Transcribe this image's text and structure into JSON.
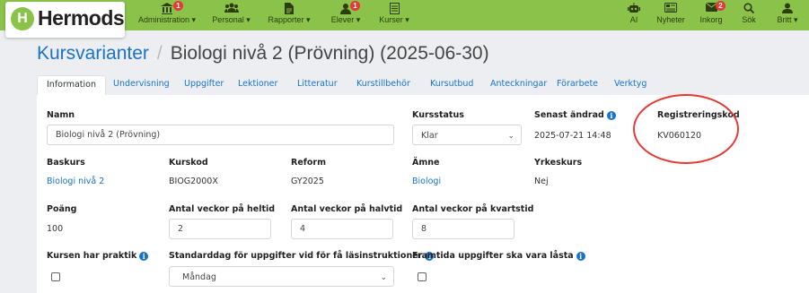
{
  "brand": {
    "logo_letter": "H",
    "name": "Hermods"
  },
  "nav_left": [
    {
      "label": "Administration ▾",
      "badge": "1"
    },
    {
      "label": "Personal ▾",
      "badge": ""
    },
    {
      "label": "Rapporter ▾",
      "badge": ""
    },
    {
      "label": "Elever ▾",
      "badge": "1"
    },
    {
      "label": "Kurser ▾",
      "badge": ""
    }
  ],
  "nav_right": [
    {
      "label": "AI",
      "badge": ""
    },
    {
      "label": "Nyheter",
      "badge": ""
    },
    {
      "label": "Inkorg",
      "badge": "2"
    },
    {
      "label": "Sök",
      "badge": ""
    },
    {
      "label": "Britt ▾",
      "badge": ""
    }
  ],
  "breadcrumb": {
    "parent": "Kursvarianter",
    "separator": "/",
    "current": "Biologi nivå 2 (Prövning) (2025-06-30)"
  },
  "tabs": [
    "Information",
    "Undervisning",
    "Uppgifter",
    "Lektioner",
    "Litteratur",
    "Kurstillbehör",
    "Kursutbud",
    "Anteckningar",
    "Förarbete",
    "Verktyg"
  ],
  "active_tab": "Information",
  "form": {
    "namn": {
      "label": "Namn",
      "value": "Biologi nivå 2 (Prövning)"
    },
    "kursstatus": {
      "label": "Kursstatus",
      "value": "Klar"
    },
    "senast_andrad": {
      "label": "Senast ändrad",
      "value": "2025-07-21 14:48"
    },
    "registreringskod": {
      "label": "Registreringskod",
      "value": "KV060120"
    },
    "baskurs": {
      "label": "Baskurs",
      "value": "Biologi nivå 2"
    },
    "kurskod": {
      "label": "Kurskod",
      "value": "BIOG2000X"
    },
    "reform": {
      "label": "Reform",
      "value": "GY2025"
    },
    "amne": {
      "label": "Ämne",
      "value": "Biologi"
    },
    "yrkeskurs": {
      "label": "Yrkeskurs",
      "value": "Nej"
    },
    "poang": {
      "label": "Poäng",
      "value": "100"
    },
    "veckor_heltid": {
      "label": "Antal veckor på heltid",
      "value": "2"
    },
    "veckor_halvtid": {
      "label": "Antal veckor på halvtid",
      "value": "4"
    },
    "veckor_kvartstid": {
      "label": "Antal veckor på kvartstid",
      "value": "8"
    },
    "praktik": {
      "label": "Kursen har praktik"
    },
    "standarddag": {
      "label": "Standarddag för uppgifter vid för få läsinstruktioner",
      "value": "Måndag"
    },
    "framtida_last": {
      "label": "Framtida uppgifter ska vara låsta"
    }
  },
  "colors": {
    "topbar": "#8bc34a",
    "link": "#1a73c7",
    "badge": "#e53935",
    "highlight": "#e53935"
  }
}
